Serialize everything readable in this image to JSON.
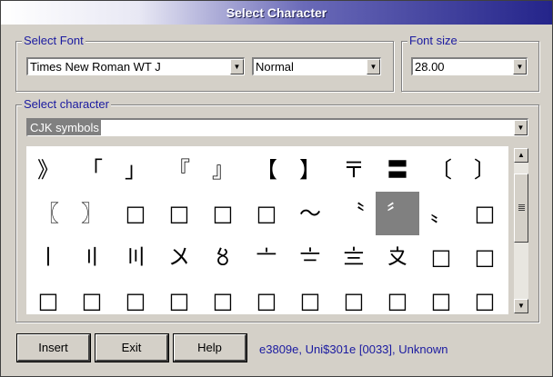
{
  "window": {
    "title": "Select Character"
  },
  "font_group": {
    "label": "Select Font",
    "font_value": "Times New Roman WT J",
    "style_value": "Normal"
  },
  "size_group": {
    "label": "Font size",
    "size_value": "28.00"
  },
  "char_group": {
    "label": "Select character",
    "range_value": "CJK symbols"
  },
  "grid": {
    "rows": [
      [
        "》",
        "「",
        "」",
        "『",
        "』",
        "【",
        "】",
        "〒",
        "〓",
        "〔",
        "〕"
      ],
      [
        "〖",
        "〗",
        "□",
        "□",
        "□",
        "□",
        "〜",
        "〝",
        "〞",
        "〟",
        "□"
      ],
      [
        "〡",
        "〢",
        "〣",
        "〤",
        "〥",
        "〦",
        "〧",
        "〨",
        "〩",
        "□",
        "□"
      ],
      [
        "□",
        "□",
        "□",
        "□",
        "□",
        "□",
        "□",
        "□",
        "□",
        "□",
        "□"
      ]
    ],
    "selected_row": 1,
    "selected_col": 8
  },
  "icons": {
    "scroll_up": "arrow-up-icon",
    "scroll_down": "arrow-down-icon",
    "combo_arrow": "chevron-down-icon"
  },
  "buttons": {
    "insert": "Insert",
    "exit": "Exit",
    "help": "Help"
  },
  "status": "e3809e, Uni$301e [0033], Unknown"
}
